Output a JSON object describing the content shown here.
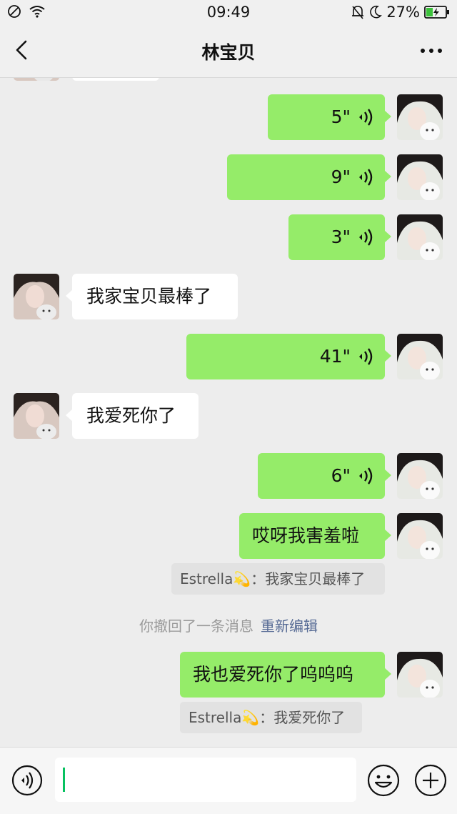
{
  "status_bar": {
    "time": "09:49",
    "battery": "27%"
  },
  "nav": {
    "title": "林宝贝",
    "back_icon": "chevron-left-icon",
    "more_icon": "more-dots-icon"
  },
  "colors": {
    "outgoing_bubble": "#95ec69",
    "incoming_bubble": "#ffffff",
    "background": "#ededed",
    "link": "#576b95"
  },
  "messages": [
    {
      "from": "me",
      "type": "voice",
      "duration": "5\""
    },
    {
      "from": "me",
      "type": "voice",
      "duration": "9\""
    },
    {
      "from": "me",
      "type": "voice",
      "duration": "3\""
    },
    {
      "from": "them",
      "type": "text",
      "text": "我家宝贝最棒了"
    },
    {
      "from": "me",
      "type": "voice",
      "duration": "41\""
    },
    {
      "from": "them",
      "type": "text",
      "text": "我爱死你了"
    },
    {
      "from": "me",
      "type": "voice",
      "duration": "6\""
    },
    {
      "from": "me",
      "type": "text",
      "text": "哎呀我害羞啦",
      "quote": "Estrella💫：我家宝贝最棒了"
    },
    {
      "from": "system",
      "text": "你撤回了一条消息",
      "link": "重新编辑"
    },
    {
      "from": "me",
      "type": "text",
      "text": "我也爱死你了呜呜呜",
      "quote": "Estrella💫：我爱死你了"
    }
  ],
  "input_bar": {
    "voice_icon": "voice-input-icon",
    "emoji_icon": "emoji-icon",
    "plus_icon": "plus-icon"
  }
}
